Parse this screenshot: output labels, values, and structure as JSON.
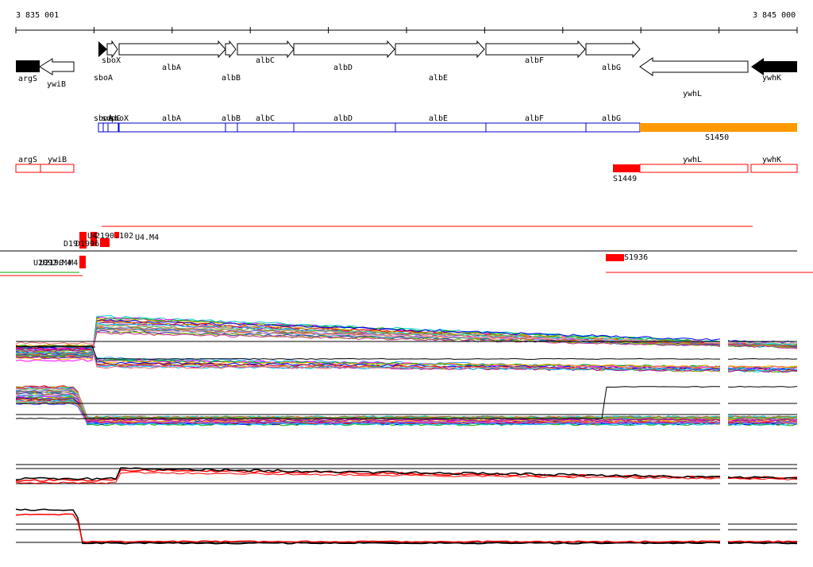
{
  "ruler": {
    "start_label": "3 835 001",
    "end_label": "3 845 000"
  },
  "genes_forward": [
    {
      "name": "sboX",
      "label_row": "top"
    },
    {
      "name": "albA",
      "label_row": "low"
    },
    {
      "name": "albB",
      "label_row": "lower"
    },
    {
      "name": "albC",
      "label_row": "top"
    },
    {
      "name": "albD",
      "label_row": "low"
    },
    {
      "name": "albE",
      "label_row": "lower"
    },
    {
      "name": "albF",
      "label_row": "top"
    },
    {
      "name": "albG",
      "label_row": "low"
    }
  ],
  "genes_reverse": [
    {
      "name": "argS",
      "filled": true
    },
    {
      "name": "ywiB",
      "filled": false
    },
    {
      "name": "sboA",
      "filled": true
    },
    {
      "name": "ywhL",
      "filled": false
    },
    {
      "name": "ywhK",
      "filled": true
    }
  ],
  "transcript_blue": [
    "sboA",
    "sdpC",
    "sboX",
    "albA",
    "albB",
    "albC",
    "albD",
    "albE",
    "albF",
    "albG"
  ],
  "transcript_orange": {
    "label": "S1450",
    "color": "#ff9900"
  },
  "transcript_red": {
    "labels": [
      "argS",
      "ywiB",
      "ywhL",
      "ywhK"
    ],
    "segment_label": "S1449",
    "color": "#ff0000"
  },
  "features": {
    "upper_labels": [
      "D19",
      "U4",
      "2190.102",
      "U4.M4",
      "D1996"
    ],
    "lower_labels": [
      "U2092.M4",
      "U2190.M4"
    ],
    "right_label": "S1936"
  },
  "colors": {
    "blue": "#0000cc",
    "orange": "#ff9900",
    "red": "#ff0000",
    "black": "#000000"
  }
}
